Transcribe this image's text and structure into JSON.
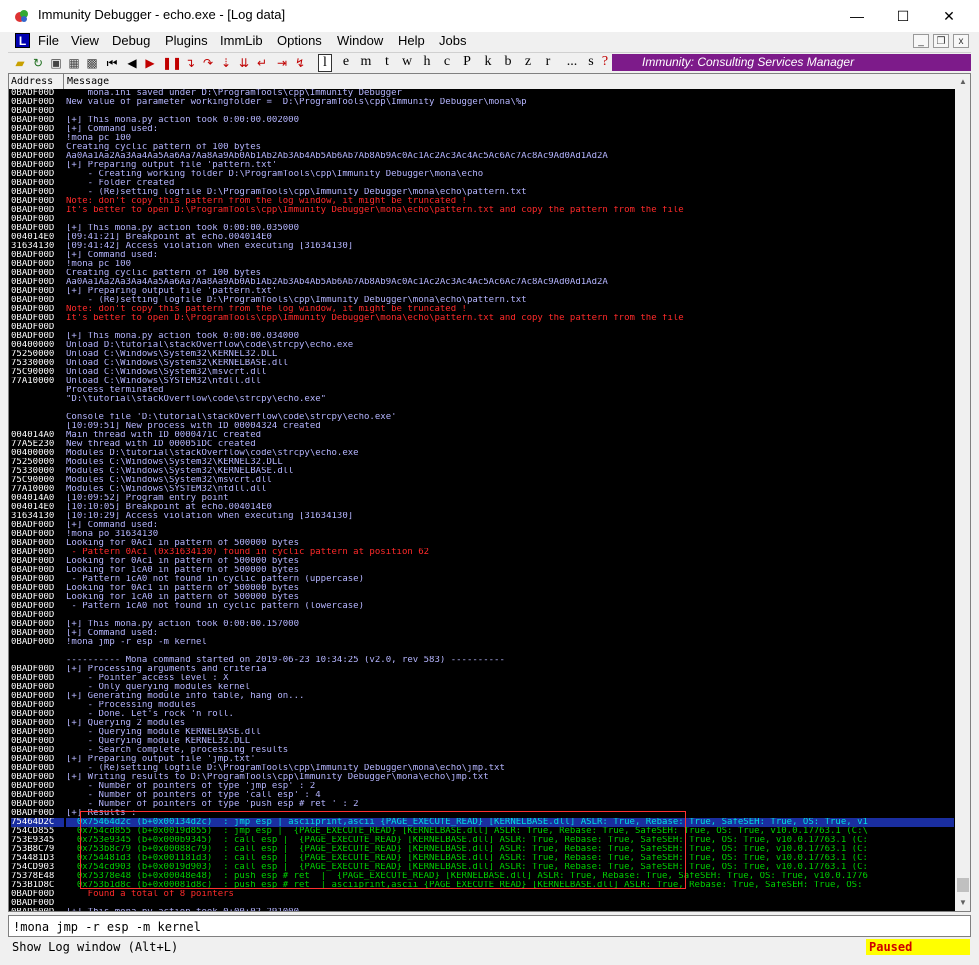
{
  "window": {
    "title": "Immunity Debugger - echo.exe - [Log data]",
    "min": "—",
    "max": "☐",
    "close": "✕"
  },
  "menu": {
    "logo": "L",
    "items": [
      "File",
      "View",
      "Debug",
      "Plugins",
      "ImmLib",
      "Options",
      "Window",
      "Help",
      "Jobs"
    ],
    "mdi_min": "_",
    "mdi_restore": "❐",
    "mdi_close": "x"
  },
  "toolbar": {
    "letters": [
      "l",
      "e",
      "m",
      "t",
      "w",
      "h",
      "c",
      "P",
      "k",
      "b",
      "z",
      "r",
      "...",
      "s",
      "?"
    ],
    "banner": "Immunity: Consulting Services Manager"
  },
  "log": {
    "col_address": "Address",
    "col_message": "Message",
    "rows": [
      {
        "a": "0BADF00D",
        "m": "    mona.ini saved under D:\\ProgramTools\\cpp\\Immunity Debugger",
        "t": ""
      },
      {
        "a": "0BADF00D",
        "m": "New value of parameter workingfolder =  D:\\ProgramTools\\cpp\\Immunity Debugger\\mona\\%p",
        "t": ""
      },
      {
        "a": "0BADF00D",
        "m": "",
        "t": ""
      },
      {
        "a": "0BADF00D",
        "m": "[+] This mona.py action took 0:00:00.002000",
        "t": ""
      },
      {
        "a": "0BADF00D",
        "m": "[+] Command used:",
        "t": ""
      },
      {
        "a": "0BADF00D",
        "m": "!mona pc 100",
        "t": ""
      },
      {
        "a": "0BADF00D",
        "m": "Creating cyclic pattern of 100 bytes",
        "t": ""
      },
      {
        "a": "0BADF00D",
        "m": "Aa0Aa1Aa2Aa3Aa4Aa5Aa6Aa7Aa8Aa9Ab0Ab1Ab2Ab3Ab4Ab5Ab6Ab7Ab8Ab9Ac0Ac1Ac2Ac3Ac4Ac5Ac6Ac7Ac8Ac9Ad0Ad1Ad2A",
        "t": ""
      },
      {
        "a": "0BADF00D",
        "m": "[+] Preparing output file 'pattern.txt'",
        "t": ""
      },
      {
        "a": "0BADF00D",
        "m": "    - Creating working folder D:\\ProgramTools\\cpp\\Immunity Debugger\\mona\\echo",
        "t": ""
      },
      {
        "a": "0BADF00D",
        "m": "    - Folder created",
        "t": ""
      },
      {
        "a": "0BADF00D",
        "m": "    - (Re)setting logfile D:\\ProgramTools\\cpp\\Immunity Debugger\\mona\\echo\\pattern.txt",
        "t": ""
      },
      {
        "a": "0BADF00D",
        "m": "Note: don't copy this pattern from the log window, it might be truncated !",
        "t": "s"
      },
      {
        "a": "0BADF00D",
        "m": "It's better to open D:\\ProgramTools\\cpp\\Immunity Debugger\\mona\\echo\\pattern.txt and copy the pattern from the file",
        "t": "s"
      },
      {
        "a": "0BADF00D",
        "m": "",
        "t": ""
      },
      {
        "a": "0BADF00D",
        "m": "[+] This mona.py action took 0:00:00.035000",
        "t": ""
      },
      {
        "a": "004014E0",
        "m": "[09:41:21] Breakpoint at echo.004014E0",
        "t": ""
      },
      {
        "a": "31634130",
        "m": "[09:41:42] Access violation when executing [31634130]",
        "t": ""
      },
      {
        "a": "0BADF00D",
        "m": "[+] Command used:",
        "t": ""
      },
      {
        "a": "0BADF00D",
        "m": "!mona pc 100",
        "t": ""
      },
      {
        "a": "0BADF00D",
        "m": "Creating cyclic pattern of 100 bytes",
        "t": ""
      },
      {
        "a": "0BADF00D",
        "m": "Aa0Aa1Aa2Aa3Aa4Aa5Aa6Aa7Aa8Aa9Ab0Ab1Ab2Ab3Ab4Ab5Ab6Ab7Ab8Ab9Ac0Ac1Ac2Ac3Ac4Ac5Ac6Ac7Ac8Ac9Ad0Ad1Ad2A",
        "t": ""
      },
      {
        "a": "0BADF00D",
        "m": "[+] Preparing output file 'pattern.txt'",
        "t": ""
      },
      {
        "a": "0BADF00D",
        "m": "    - (Re)setting logfile D:\\ProgramTools\\cpp\\Immunity Debugger\\mona\\echo\\pattern.txt",
        "t": ""
      },
      {
        "a": "0BADF00D",
        "m": "Note: don't copy this pattern from the log window, it might be truncated !",
        "t": "s"
      },
      {
        "a": "0BADF00D",
        "m": "It's better to open D:\\ProgramTools\\cpp\\Immunity Debugger\\mona\\echo\\pattern.txt and copy the pattern from the file",
        "t": "s"
      },
      {
        "a": "0BADF00D",
        "m": "",
        "t": ""
      },
      {
        "a": "0BADF00D",
        "m": "[+] This mona.py action took 0:00:00.034000",
        "t": ""
      },
      {
        "a": "00400000",
        "m": "Unload D:\\tutorial\\stackOverflow\\code\\strcpy\\echo.exe",
        "t": ""
      },
      {
        "a": "75250000",
        "m": "Unload C:\\Windows\\System32\\KERNEL32.DLL",
        "t": ""
      },
      {
        "a": "75330000",
        "m": "Unload C:\\Windows\\System32\\KERNELBASE.dll",
        "t": ""
      },
      {
        "a": "75C90000",
        "m": "Unload C:\\Windows\\System32\\msvcrt.dll",
        "t": ""
      },
      {
        "a": "77A10000",
        "m": "Unload C:\\Windows\\SYSTEM32\\ntdll.dll",
        "t": ""
      },
      {
        "a": "",
        "m": "Process terminated",
        "t": ""
      },
      {
        "a": "",
        "m": "\"D:\\tutorial\\stackOverflow\\code\\strcpy\\echo.exe\"",
        "t": ""
      },
      {
        "a": "",
        "m": "",
        "t": ""
      },
      {
        "a": "",
        "m": "Console file 'D:\\tutorial\\stackOverflow\\code\\strcpy\\echo.exe'",
        "t": ""
      },
      {
        "a": "",
        "m": "[10:09:51] New process with ID 00004324 created",
        "t": ""
      },
      {
        "a": "004014A0",
        "m": "Main thread with ID 0000471C created",
        "t": ""
      },
      {
        "a": "77A5E230",
        "m": "New thread with ID 000051DC created",
        "t": ""
      },
      {
        "a": "00400000",
        "m": "Modules D:\\tutorial\\stackOverflow\\code\\strcpy\\echo.exe",
        "t": ""
      },
      {
        "a": "75250000",
        "m": "Modules C:\\Windows\\System32\\KERNEL32.DLL",
        "t": ""
      },
      {
        "a": "75330000",
        "m": "Modules C:\\Windows\\System32\\KERNELBASE.dll",
        "t": ""
      },
      {
        "a": "75C90000",
        "m": "Modules C:\\Windows\\System32\\msvcrt.dll",
        "t": ""
      },
      {
        "a": "77A10000",
        "m": "Modules C:\\Windows\\SYSTEM32\\ntdll.dll",
        "t": ""
      },
      {
        "a": "004014A0",
        "m": "[10:09:52] Program entry point",
        "t": ""
      },
      {
        "a": "004014E0",
        "m": "[10:10:05] Breakpoint at echo.004014E0",
        "t": ""
      },
      {
        "a": "31634130",
        "m": "[10:10:29] Access violation when executing [31634130]",
        "t": ""
      },
      {
        "a": "0BADF00D",
        "m": "[+] Command used:",
        "t": ""
      },
      {
        "a": "0BADF00D",
        "m": "!mona po 31634130",
        "t": ""
      },
      {
        "a": "0BADF00D",
        "m": "Looking for 0Ac1 in pattern of 500000 bytes",
        "t": ""
      },
      {
        "a": "0BADF00D",
        "m": " - Pattern 0Ac1 (0x31634130) found in cyclic pattern at position 62",
        "t": "s"
      },
      {
        "a": "0BADF00D",
        "m": "Looking for 0Ac1 in pattern of 500000 bytes",
        "t": ""
      },
      {
        "a": "0BADF00D",
        "m": "Looking for 1cA0 in pattern of 500000 bytes",
        "t": ""
      },
      {
        "a": "0BADF00D",
        "m": " - Pattern 1cA0 not found in cyclic pattern (uppercase)",
        "t": ""
      },
      {
        "a": "0BADF00D",
        "m": "Looking for 0Ac1 in pattern of 500000 bytes",
        "t": ""
      },
      {
        "a": "0BADF00D",
        "m": "Looking for 1cA0 in pattern of 500000 bytes",
        "t": ""
      },
      {
        "a": "0BADF00D",
        "m": " - Pattern 1cA0 not found in cyclic pattern (lowercase)",
        "t": ""
      },
      {
        "a": "0BADF00D",
        "m": "",
        "t": ""
      },
      {
        "a": "0BADF00D",
        "m": "[+] This mona.py action took 0:00:00.157000",
        "t": ""
      },
      {
        "a": "0BADF00D",
        "m": "[+] Command used:",
        "t": ""
      },
      {
        "a": "0BADF00D",
        "m": "!mona jmp -r esp -m kernel",
        "t": ""
      },
      {
        "a": "",
        "m": "",
        "t": ""
      },
      {
        "a": "",
        "m": "---------- Mona command started on 2019-06-23 10:34:25 (v2.0, rev 583) ----------",
        "t": ""
      },
      {
        "a": "0BADF00D",
        "m": "[+] Processing arguments and criteria",
        "t": ""
      },
      {
        "a": "0BADF00D",
        "m": "    - Pointer access level : X",
        "t": ""
      },
      {
        "a": "0BADF00D",
        "m": "    - Only querying modules kernel",
        "t": ""
      },
      {
        "a": "0BADF00D",
        "m": "[+] Generating module info table, hang on...",
        "t": ""
      },
      {
        "a": "0BADF00D",
        "m": "    - Processing modules",
        "t": ""
      },
      {
        "a": "0BADF00D",
        "m": "    - Done. Let's rock 'n roll.",
        "t": ""
      },
      {
        "a": "0BADF00D",
        "m": "[+] Querying 2 modules",
        "t": ""
      },
      {
        "a": "0BADF00D",
        "m": "    - Querying module KERNELBASE.dll",
        "t": ""
      },
      {
        "a": "0BADF00D",
        "m": "    - Querying module KERNEL32.DLL",
        "t": ""
      },
      {
        "a": "0BADF00D",
        "m": "    - Search complete, processing results",
        "t": ""
      },
      {
        "a": "0BADF00D",
        "m": "[+] Preparing output file 'jmp.txt'",
        "t": ""
      },
      {
        "a": "0BADF00D",
        "m": "    - (Re)setting logfile D:\\ProgramTools\\cpp\\Immunity Debugger\\mona\\echo\\jmp.txt",
        "t": ""
      },
      {
        "a": "0BADF00D",
        "m": "[+] Writing results to D:\\ProgramTools\\cpp\\Immunity Debugger\\mona\\echo\\jmp.txt",
        "t": ""
      },
      {
        "a": "0BADF00D",
        "m": "    - Number of pointers of type 'jmp esp' : 2",
        "t": ""
      },
      {
        "a": "0BADF00D",
        "m": "    - Number of pointers of type 'call esp' : 4",
        "t": ""
      },
      {
        "a": "0BADF00D",
        "m": "    - Number of pointers of type 'push esp # ret ' : 2",
        "t": ""
      },
      {
        "a": "0BADF00D",
        "m": "[+] Results :",
        "t": ""
      },
      {
        "a": "75464D2C",
        "m": "  0x75464d2c (b+0x00134d2c)  : jmp esp | asciiprint,ascii {PAGE_EXECUTE_READ} [KERNELBASE.dll] ASLR: True, Rebase: True, SafeSEH: True, OS: True, v1",
        "t": "rs"
      },
      {
        "a": "754CD855",
        "m": "  0x754cd855 (b+0x0019d855)  : jmp esp |  {PAGE_EXECUTE_READ} [KERNELBASE.dll] ASLR: True, Rebase: True, SafeSEH: True, OS: True, v10.0.17763.1 (C:\\",
        "t": "r"
      },
      {
        "a": "753E9345",
        "m": "  0x753e9345 (b+0x000b9345)  : call esp |  {PAGE_EXECUTE_READ} [KERNELBASE.dll] ASLR: True, Rebase: True, SafeSEH: True, OS: True, v10.0.17763.1 (C:",
        "t": "r"
      },
      {
        "a": "753B8C79",
        "m": "  0x753b8c79 (b+0x00088c79)  : call esp |  {PAGE_EXECUTE_READ} [KERNELBASE.dll] ASLR: True, Rebase: True, SafeSEH: True, OS: True, v10.0.17763.1 (C:",
        "t": "r"
      },
      {
        "a": "754481D3",
        "m": "  0x754481d3 (b+0x001181d3)  : call esp |  {PAGE_EXECUTE_READ} [KERNELBASE.dll] ASLR: True, Rebase: True, SafeSEH: True, OS: True, v10.0.17763.1 (C:",
        "t": "r"
      },
      {
        "a": "754CD903",
        "m": "  0x754cd903 (b+0x0019d903)  : call esp |  {PAGE_EXECUTE_READ} [KERNELBASE.dll] ASLR: True, Rebase: True, SafeSEH: True, OS: True, v10.0.17763.1 (C:",
        "t": "r"
      },
      {
        "a": "75378E48",
        "m": "  0x75378e48 (b+0x00048e48)  : push esp # ret  |  {PAGE_EXECUTE_READ} [KERNELBASE.dll] ASLR: True, Rebase: True, SafeSEH: True, OS: True, v10.0.1776",
        "t": "r"
      },
      {
        "a": "753B1D8C",
        "m": "  0x753b1d8c (b+0x00081d8c)  : push esp # ret  | asciiprint,ascii {PAGE_EXECUTE_READ} [KERNELBASE.dll] ASLR: True, Rebase: True, SafeSEH: True, OS:",
        "t": "r"
      },
      {
        "a": "0BADF00D",
        "m": "    Found a total of 8 pointers",
        "t": "s"
      },
      {
        "a": "0BADF00D",
        "m": "",
        "t": ""
      },
      {
        "a": "0BADF00D",
        "m": "[+] This mona.py action took 0:00:02.291000",
        "t": ""
      }
    ]
  },
  "command": {
    "value": "!mona jmp -r esp -m kernel"
  },
  "status": {
    "hint": "Show Log window (Alt+L)",
    "state": "Paused"
  }
}
